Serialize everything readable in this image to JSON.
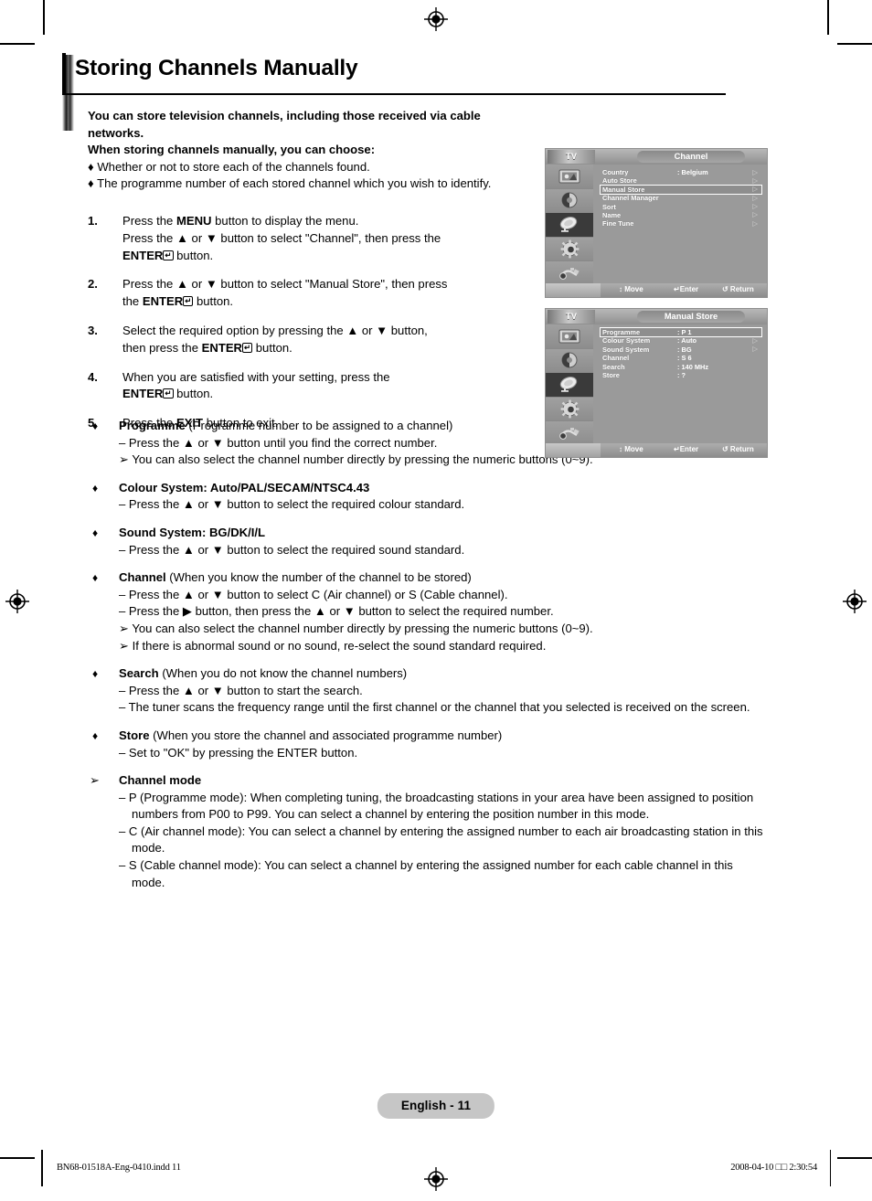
{
  "page": {
    "title": "Storing Channels Manually",
    "badge": "English - 11"
  },
  "lead": {
    "line1": "You can store television channels, including those received via cable networks.",
    "line2": "When storing channels manually, you can choose:",
    "bullet1": "♦ Whether or not to store each of the channels found.",
    "bullet2": "♦ The programme number of each stored channel which you wish to identify."
  },
  "steps": [
    {
      "num": "1.",
      "text": "Press the MENU button to display the menu. Press the ▲ or ▼ button to select \"Channel\", then press the ENTER button."
    },
    {
      "num": "2.",
      "text": "Press the ▲ or ▼ button to select \"Manual Store\", then press the ENTER button."
    },
    {
      "num": "3.",
      "text": "Select the required option by pressing the ▲ or ▼ button, then press the ENTER button."
    },
    {
      "num": "4.",
      "text": "When you are satisfied with your setting, press the ENTER button."
    },
    {
      "num": "5.",
      "text": "Press the EXIT button to exit."
    }
  ],
  "step_parts": {
    "s1a": "Press the ",
    "s1_menu": "MENU",
    "s1b": " button to display the menu.",
    "s1c": "Press the ▲ or ▼ button to select \"Channel\", then press the",
    "s1_enter": "ENTER",
    "s1d": " button.",
    "s2a": "Press the ▲ or ▼ button to select \"Manual Store\", then press",
    "s2b": "the ",
    "s2c": " button.",
    "s3a": "Select the required option by pressing the ▲ or ▼ button,",
    "s3b": "then press the ",
    "s3c": " button.",
    "s4a": "When you are satisfied with your setting, press the",
    "s4b": " button.",
    "s5a": "Press the ",
    "s5_exit": "EXIT",
    "s5b": " button to exit."
  },
  "bullets": [
    {
      "mark": "♦",
      "heading_bold": "Programme",
      "heading_rest": " (Programme number to be assigned to a channel)",
      "lines": [
        {
          "prefix": "–",
          "text": "Press the ▲ or ▼ button until you find the correct number."
        },
        {
          "prefix": "➢",
          "text": "You can also select the channel number directly by pressing the numeric buttons (0~9)."
        }
      ]
    },
    {
      "mark": "♦",
      "heading_bold": "Colour System: Auto/PAL/SECAM/NTSC4.43",
      "heading_rest": "",
      "lines": [
        {
          "prefix": "–",
          "text": "Press the ▲ or ▼ button to select the required colour standard."
        }
      ]
    },
    {
      "mark": "♦",
      "heading_bold": "Sound System: BG/DK/I/L",
      "heading_rest": "",
      "lines": [
        {
          "prefix": "–",
          "text": "Press the ▲ or ▼ button to select the required sound standard."
        }
      ]
    },
    {
      "mark": "♦",
      "heading_bold": "Channel",
      "heading_rest": " (When you know the number of the channel to be stored)",
      "lines": [
        {
          "prefix": "–",
          "text": "Press the ▲ or ▼ button to select C (Air channel) or S (Cable channel)."
        },
        {
          "prefix": "–",
          "text": "Press the ▶ button, then press the ▲ or ▼ button to select the required number."
        },
        {
          "prefix": "➢",
          "text": "You can also select the channel number directly by pressing the numeric buttons (0~9)."
        },
        {
          "prefix": "➢",
          "text": "If there is abnormal sound or no sound, re-select the sound standard required."
        }
      ]
    },
    {
      "mark": "♦",
      "heading_bold": "Search",
      "heading_rest": " (When you do not know the channel numbers)",
      "lines": [
        {
          "prefix": "–",
          "text": "Press the ▲ or ▼ button to start the search."
        },
        {
          "prefix": "–",
          "text": "The tuner scans the frequency range until the first channel or the channel that you selected is received on the screen."
        }
      ]
    },
    {
      "mark": "♦",
      "heading_bold": "Store",
      "heading_rest": " (When you store the channel and associated programme number)",
      "lines": [
        {
          "prefix": "–",
          "text": "Set to \"OK\" by pressing the ENTER button."
        }
      ]
    },
    {
      "mark": "➢",
      "heading_bold": "Channel mode",
      "heading_rest": "",
      "lines": [
        {
          "prefix": "–",
          "text": "P (Programme mode): When completing tuning, the broadcasting stations in your area have been assigned to position numbers from P00 to P99. You can select a channel by entering the position number in this mode."
        },
        {
          "prefix": "–",
          "text": "C (Air channel mode): You can select a channel by entering the assigned number to each air broadcasting station in this mode."
        },
        {
          "prefix": "–",
          "text": "S (Cable channel mode): You can select a channel by entering the assigned number for each cable channel in this mode."
        }
      ]
    }
  ],
  "osd_channel": {
    "tv_label": "TV",
    "title": "Channel",
    "icons": [
      "picture-icon",
      "sound-icon",
      "channel-dish-icon",
      "setup-gear-icon",
      "input-plug-icon"
    ],
    "selected_icon_index": 2,
    "rows": [
      {
        "label": "Country",
        "value": ": Belgium",
        "arrow": "▷",
        "highlight": false
      },
      {
        "label": "Auto Store",
        "value": "",
        "arrow": "▷",
        "highlight": false
      },
      {
        "label": "Manual Store",
        "value": "",
        "arrow": "▷",
        "highlight": true
      },
      {
        "label": "Channel Manager",
        "value": "",
        "arrow": "▷",
        "highlight": false
      },
      {
        "label": "Sort",
        "value": "",
        "arrow": "▷",
        "highlight": false
      },
      {
        "label": "Name",
        "value": "",
        "arrow": "▷",
        "highlight": false
      },
      {
        "label": "Fine Tune",
        "value": "",
        "arrow": "▷",
        "highlight": false
      }
    ],
    "footer": {
      "move": "↕ Move",
      "enter": "↵Enter",
      "return": "↺ Return"
    }
  },
  "osd_manual": {
    "tv_label": "TV",
    "title": "Manual Store",
    "icons": [
      "picture-icon",
      "sound-icon",
      "channel-dish-icon",
      "setup-gear-icon",
      "input-plug-icon"
    ],
    "selected_icon_index": 2,
    "rows": [
      {
        "label": "Programme",
        "value": ": P 1",
        "arrow": "",
        "highlight": true
      },
      {
        "label": "Colour System",
        "value": ": Auto",
        "arrow": "▷",
        "highlight": false
      },
      {
        "label": "Sound System",
        "value": ": BG",
        "arrow": "▷",
        "highlight": false
      },
      {
        "label": "Channel",
        "value": ": S 6",
        "arrow": "",
        "highlight": false
      },
      {
        "label": "Search",
        "value": ": 140 MHz",
        "arrow": "",
        "highlight": false
      },
      {
        "label": "Store",
        "value": ": ?",
        "arrow": "",
        "highlight": false
      }
    ],
    "footer": {
      "move": "↕ Move",
      "enter": "↵Enter",
      "return": "↺ Return"
    }
  },
  "slug": {
    "left": "BN68-01518A-Eng-0410.indd   11",
    "right": "2008-04-10   □□ 2:30:54"
  }
}
